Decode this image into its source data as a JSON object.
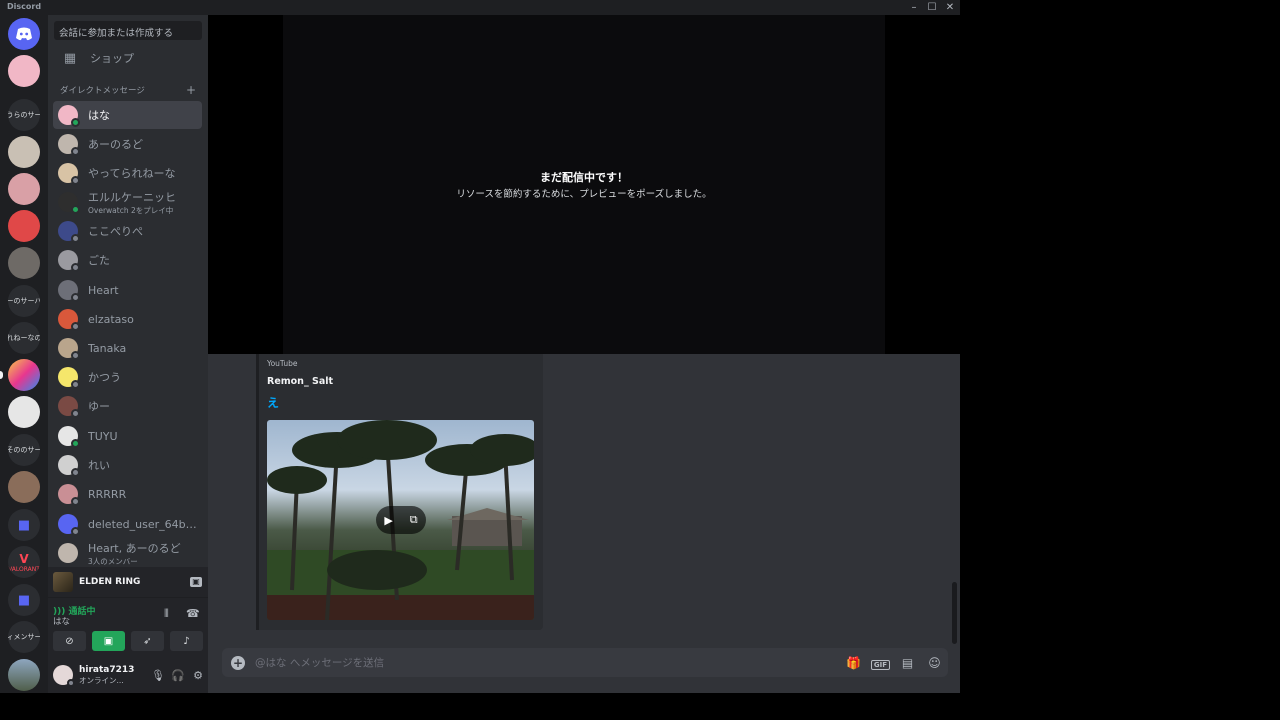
{
  "window": {
    "title": "Discord"
  },
  "servers": [
    "うらのサー",
    "ーのサーバ",
    "れねーなの",
    "そののサー",
    "VALORANT",
    "ィメンサー"
  ],
  "sidebar": {
    "search_placeholder": "会話に参加または作成する",
    "shop_label": "ショップ",
    "dm_header": "ダイレクトメッセージ",
    "dms": [
      {
        "name": "はな",
        "sub": ""
      },
      {
        "name": "あーのるど",
        "sub": ""
      },
      {
        "name": "やってられねーな",
        "sub": ""
      },
      {
        "name": "エルルケーニッヒ",
        "sub": "Overwatch 2をプレイ中"
      },
      {
        "name": "ここぺりぺ",
        "sub": ""
      },
      {
        "name": "ごた",
        "sub": ""
      },
      {
        "name": "Heart",
        "sub": ""
      },
      {
        "name": "elzataso",
        "sub": ""
      },
      {
        "name": "Tanaka",
        "sub": ""
      },
      {
        "name": "かつう",
        "sub": ""
      },
      {
        "name": "ゆー",
        "sub": ""
      },
      {
        "name": "TUYU",
        "sub": ""
      },
      {
        "name": "れい",
        "sub": ""
      },
      {
        "name": "RRRRR",
        "sub": ""
      },
      {
        "name": "deleted_user_64b4ca...",
        "sub": ""
      },
      {
        "name": "Heart, あーのるど",
        "sub": "3人のメンバー"
      }
    ]
  },
  "game": {
    "name": "ELDEN RING"
  },
  "voice": {
    "status": "通話中",
    "channel": "はな"
  },
  "user": {
    "name": "hirata7213",
    "status": "オンライン..."
  },
  "stream": {
    "title": "まだ配信中です！",
    "subtitle": "リソースを節約するために、プレビューをポーズしました。"
  },
  "embed": {
    "provider": "YouTube",
    "author": "Remon_ Salt",
    "title": "え"
  },
  "composer": {
    "placeholder": "@はな へメッセージを送信",
    "gif_label": "GIF"
  }
}
